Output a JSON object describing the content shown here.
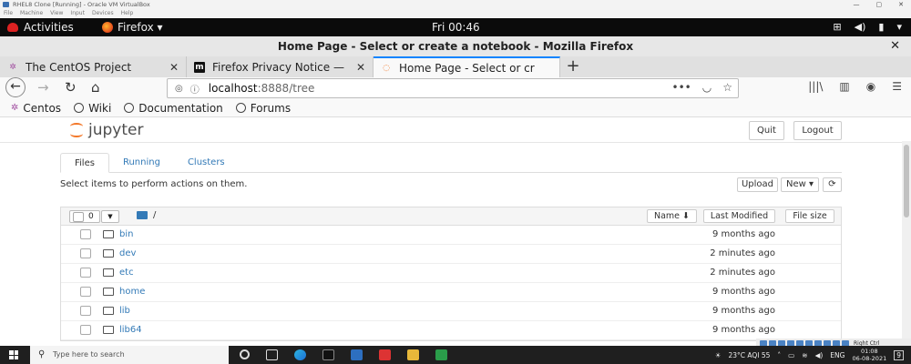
{
  "vbox": {
    "title": "RHEL8 Clone [Running] - Oracle VM VirtualBox",
    "menu": [
      "File",
      "Machine",
      "View",
      "Input",
      "Devices",
      "Help"
    ],
    "controls": [
      "—",
      "▢",
      "✕"
    ],
    "status_text": "Right Ctrl"
  },
  "gnome": {
    "activities": "Activities",
    "app_menu": "Firefox ▾",
    "clock": "Fri 00:46"
  },
  "firefox": {
    "window_title": "Home Page - Select or create a notebook - Mozilla Firefox",
    "tabs": [
      {
        "label": "The CentOS Project",
        "icon": "centos-icon",
        "active": false
      },
      {
        "label": "Firefox Privacy Notice —",
        "icon": "mozilla-m-icon",
        "active": false
      },
      {
        "label": "Home Page - Select or cr",
        "icon": "jupyter-tab-icon",
        "active": true
      }
    ],
    "url_host": "localhost",
    "url_path": ":8888/tree",
    "bookmarks": [
      "Centos",
      "Wiki",
      "Documentation",
      "Forums"
    ]
  },
  "jupyter": {
    "logo_text": "jupyter",
    "quit_label": "Quit",
    "logout_label": "Logout",
    "tabs": [
      "Files",
      "Running",
      "Clusters"
    ],
    "active_tab": "Files",
    "instruction": "Select items to perform actions on them.",
    "upload_label": "Upload",
    "new_label": "New ▾",
    "refresh_icon": "refresh-icon",
    "selected_count": "0",
    "breadcrumb": "/",
    "columns": {
      "name": "Name ⬇",
      "last_modified": "Last Modified",
      "file_size": "File size"
    },
    "rows": [
      {
        "name": "bin",
        "modified": "9 months ago"
      },
      {
        "name": "dev",
        "modified": "2 minutes ago"
      },
      {
        "name": "etc",
        "modified": "2 minutes ago"
      },
      {
        "name": "home",
        "modified": "9 months ago"
      },
      {
        "name": "lib",
        "modified": "9 months ago"
      },
      {
        "name": "lib64",
        "modified": "9 months ago"
      }
    ]
  },
  "taskbar": {
    "search_placeholder": "Type here to search",
    "weather": "23°C  AQI 55",
    "lang": "ENG",
    "time": "01:08",
    "date": "06-08-2021",
    "notifications": "9"
  }
}
